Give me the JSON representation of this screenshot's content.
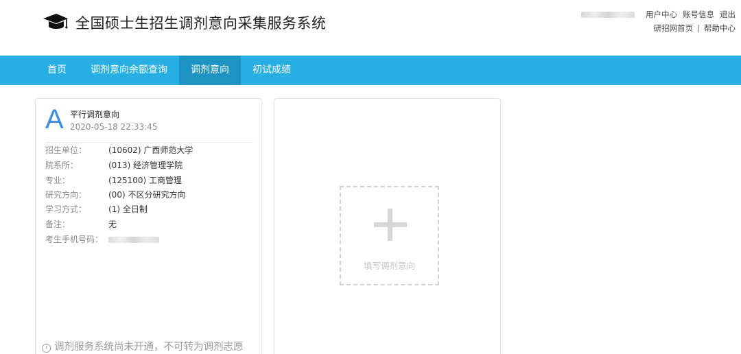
{
  "header": {
    "title": "全国硕士生招生调剂意向采集服务系统",
    "logo_icon": "graduation-cap-icon",
    "links_top": [
      "用户中心",
      "账号信息",
      "退出"
    ],
    "links_bottom": [
      "研招网首页",
      "帮助中心"
    ],
    "separator": "|"
  },
  "nav": {
    "items": [
      "首页",
      "调剂意向余额查询",
      "调剂意向",
      "初试成绩"
    ],
    "active_index": 2,
    "color": "#27aee3",
    "active_color": "#1d93c3"
  },
  "intent_card": {
    "badge": "A",
    "type": "平行调剂意向",
    "time": "2020-05-18 22:33:45",
    "fields": [
      {
        "label": "招生单位：",
        "value": "(10602) 广西师范大学"
      },
      {
        "label": "院系所：",
        "value": "(013) 经济管理学院"
      },
      {
        "label": "专业：",
        "value": "(125100) 工商管理"
      },
      {
        "label": "研究方向：",
        "value": "(00) 不区分研究方向"
      },
      {
        "label": "学习方式：",
        "value": "(1) 全日制"
      },
      {
        "label": "备注：",
        "value": "无"
      },
      {
        "label": "考生手机号码：",
        "value": ""
      }
    ],
    "notice": "调剂服务系统尚未开通，不可转为调剂志愿",
    "accent_color": "#3c8ee0"
  },
  "add_card": {
    "label": "填写调剂意向",
    "icon": "plus-icon"
  }
}
